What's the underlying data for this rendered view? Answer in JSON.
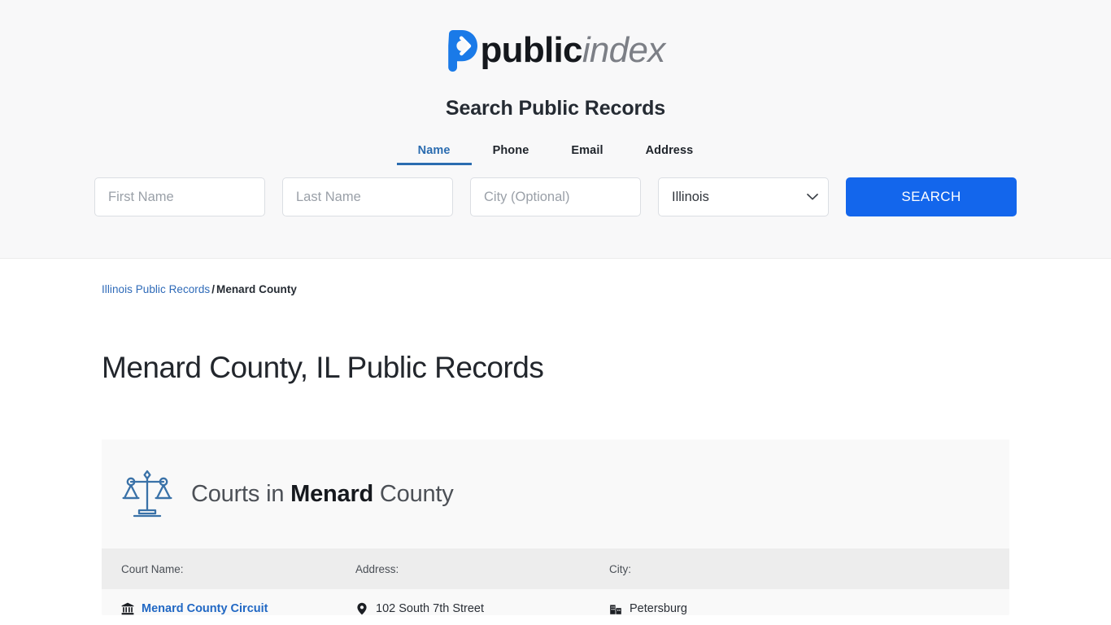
{
  "brand": {
    "logo_icon": "public-index-p-arrow-logo",
    "name_bold": "public",
    "name_italic": "index",
    "accent_blue": "#1a7ae8",
    "text_dark": "#15181d",
    "text_gray": "#7c7f86"
  },
  "search": {
    "heading": "Search Public Records",
    "tabs": [
      {
        "label": "Name",
        "active": true
      },
      {
        "label": "Phone",
        "active": false
      },
      {
        "label": "Email",
        "active": false
      },
      {
        "label": "Address",
        "active": false
      }
    ],
    "first_name": {
      "value": "",
      "placeholder": "First Name"
    },
    "last_name": {
      "value": "",
      "placeholder": "Last Name"
    },
    "city": {
      "value": "",
      "placeholder": "City (Optional)"
    },
    "state": {
      "selected": "Illinois",
      "options": [
        "Illinois"
      ],
      "chevron_icon": "chevron-down-icon"
    },
    "submit_label": "SEARCH",
    "submit_color": "#1366ec",
    "active_tab_color": "#2b6cb0"
  },
  "breadcrumb": {
    "parent_label": "Illinois Public Records",
    "separator": "/",
    "current_label": "Menard County"
  },
  "page": {
    "title": "Menard County, IL Public Records"
  },
  "courts_card": {
    "icon": "scales-of-justice-icon",
    "icon_color": "#3a72a8",
    "title_prefix": "Courts in",
    "title_strong": "Menard",
    "title_suffix": "County",
    "columns": [
      "Court Name:",
      "Address:",
      "City:"
    ],
    "rows": [
      {
        "court_name": "Menard County Circuit",
        "court_name_icon": "bank-courthouse-icon",
        "address": "102 South 7th Street",
        "address_icon": "map-pin-icon",
        "city": "Petersburg",
        "city_icon": "city-buildings-icon"
      }
    ]
  }
}
